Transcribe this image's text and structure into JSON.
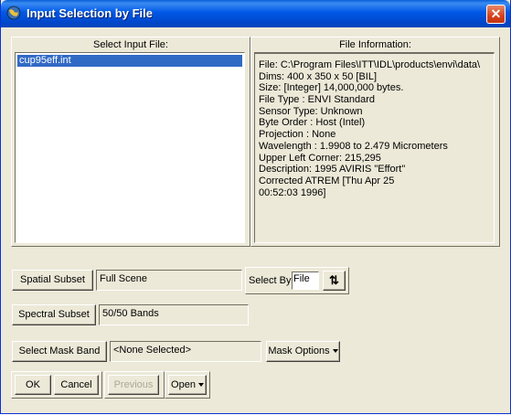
{
  "window": {
    "title": "Input Selection by File",
    "close_glyph": "✕"
  },
  "select_input": {
    "title": "Select Input File:",
    "files": [
      "cup95eff.int"
    ]
  },
  "file_info": {
    "title": "File Information:",
    "lines": [
      "File: C:\\Program Files\\ITT\\IDL\\products\\envi\\data\\",
      "Dims: 400 x 350 x 50 [BIL]",
      "Size: [Integer] 14,000,000 bytes.",
      "File Type  : ENVI Standard",
      "Sensor Type: Unknown",
      "Byte Order : Host (Intel)",
      "Projection : None",
      "Wavelength : 1.9908 to 2.479 Micrometers",
      "Upper Left Corner: 215,295",
      "Description: 1995 AVIRIS \"Effort\"",
      "Corrected ATREM [Thu Apr 25",
      "00:52:03 1996]"
    ]
  },
  "spatial": {
    "button": "Spatial Subset",
    "value": "Full Scene"
  },
  "select_by": {
    "label": "Select By",
    "value": "File",
    "toggle_glyph": "⇅"
  },
  "spectral": {
    "button": "Spectral Subset",
    "value": "50/50 Bands"
  },
  "mask": {
    "button": "Select Mask Band",
    "value": "<None Selected>",
    "options": "Mask Options"
  },
  "footer": {
    "ok": "OK",
    "cancel": "Cancel",
    "previous": "Previous",
    "open": "Open"
  },
  "colors": {
    "titlebar": "#0058e6",
    "face": "#ece9d8",
    "selection": "#316ac5"
  }
}
